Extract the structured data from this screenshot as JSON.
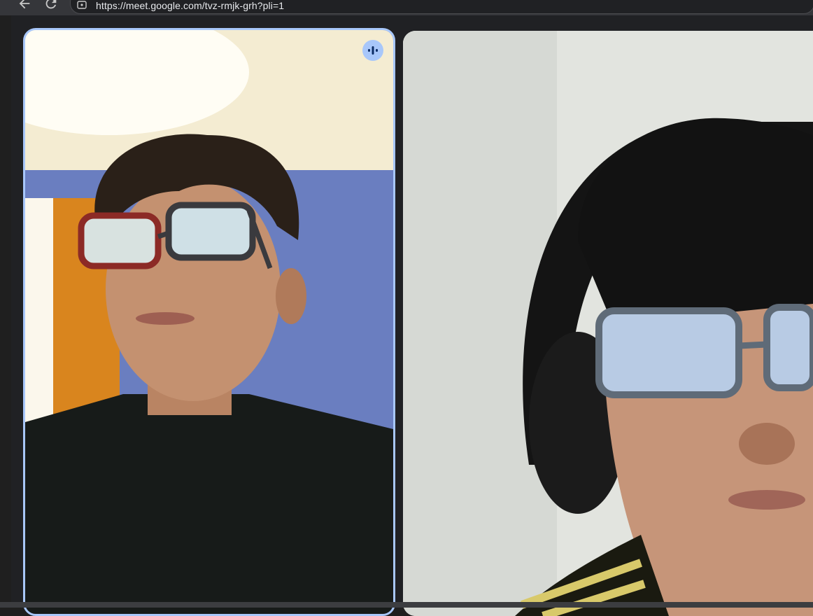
{
  "browser": {
    "url": "https://meet.google.com/tvz-rmjk-grh?pli=1",
    "back_icon": "arrow-left-icon",
    "reload_icon": "reload-icon",
    "site_info_icon": "tune-icon"
  },
  "meeting": {
    "participants": [
      {
        "tile": "participant-tile-1",
        "speaking": true
      },
      {
        "tile": "participant-tile-2",
        "speaking": false
      }
    ],
    "speaking_icon": "audio-level-icon",
    "colors": {
      "active_speaker_border": "#a8c7fa",
      "stage_background": "#202124"
    }
  }
}
